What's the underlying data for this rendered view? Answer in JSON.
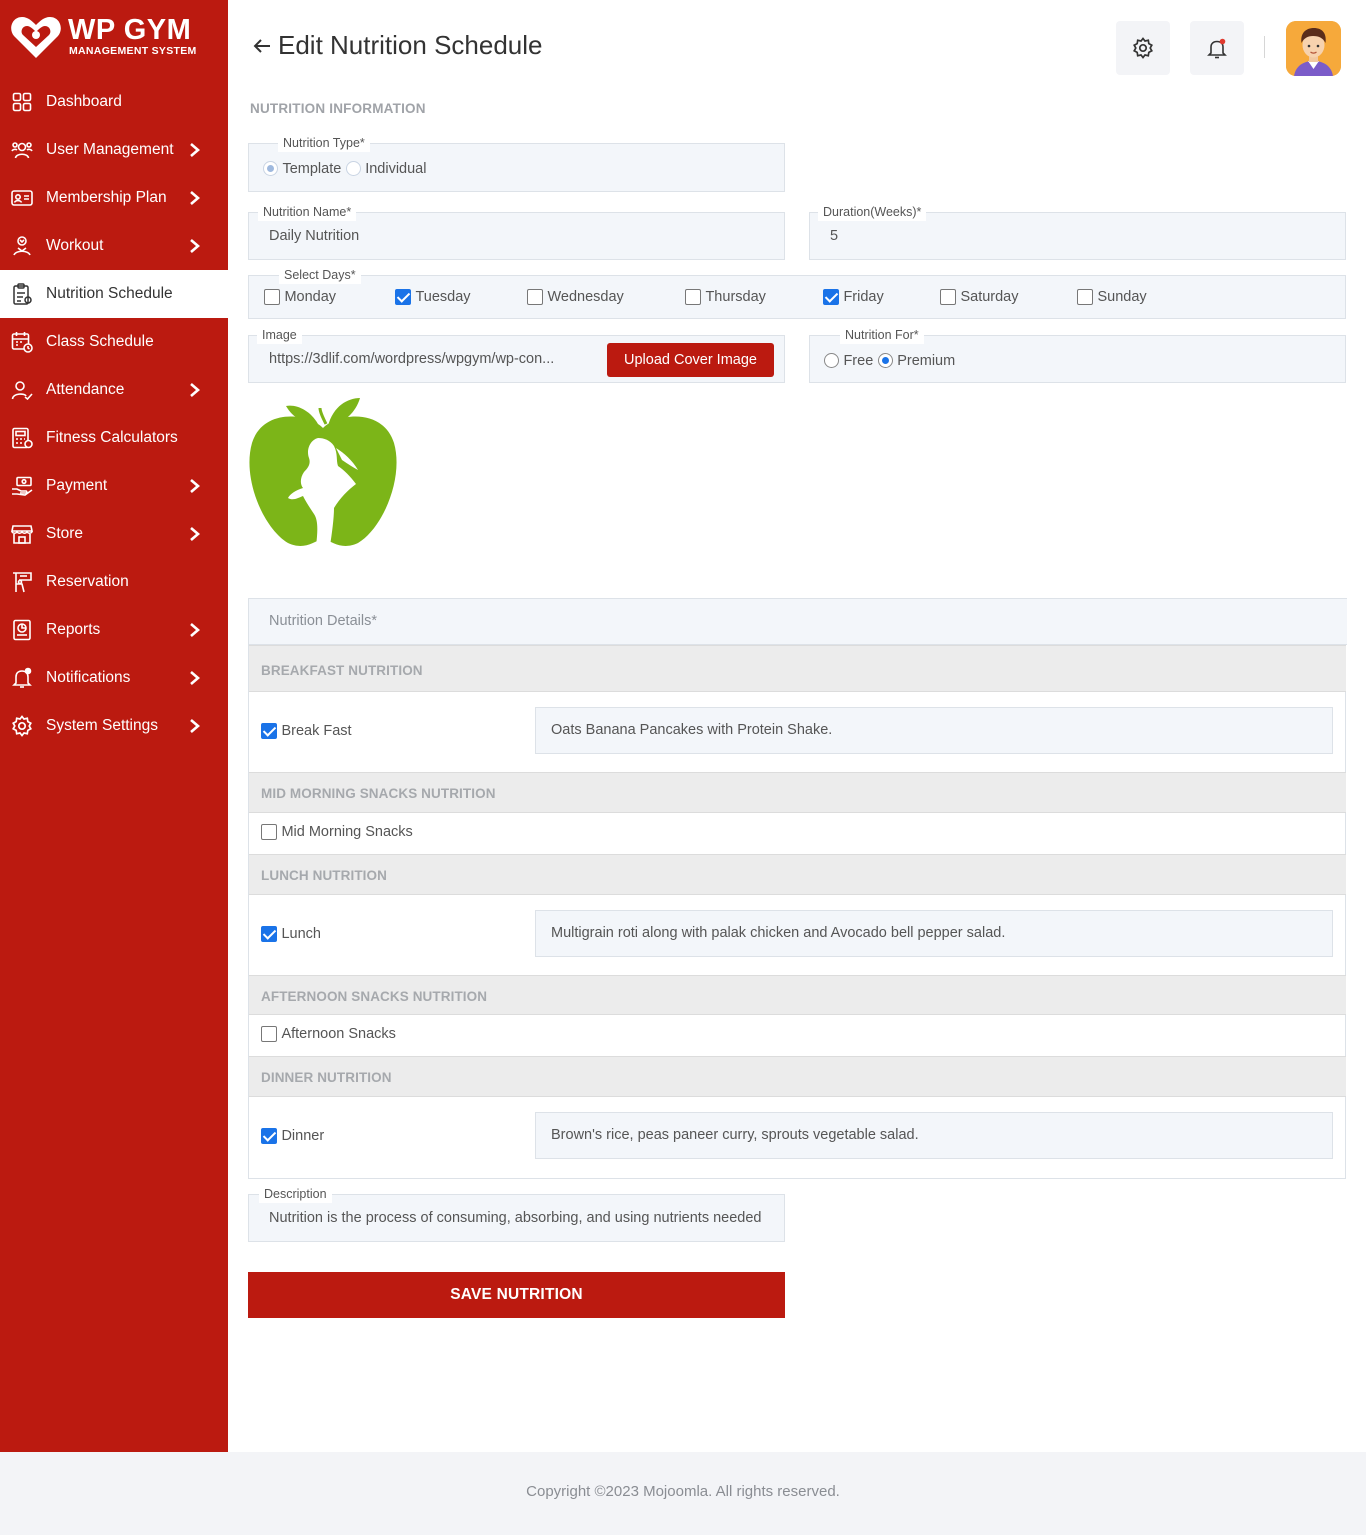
{
  "brand": {
    "title": "WP GYM",
    "subtitle": "MANAGEMENT SYSTEM"
  },
  "sidebar": {
    "items": [
      {
        "label": "Dashboard",
        "icon": "dashboard-icon",
        "chevron": false
      },
      {
        "label": "User Management",
        "icon": "users-icon",
        "chevron": true
      },
      {
        "label": "Membership Plan",
        "icon": "membership-card-icon",
        "chevron": true
      },
      {
        "label": "Workout",
        "icon": "workout-icon",
        "chevron": true
      },
      {
        "label": "Nutrition Schedule",
        "icon": "nutrition-clipboard-icon",
        "chevron": false,
        "active": true
      },
      {
        "label": "Class Schedule",
        "icon": "calendar-icon",
        "chevron": false
      },
      {
        "label": "Attendance",
        "icon": "user-check-icon",
        "chevron": true
      },
      {
        "label": "Fitness Calculators",
        "icon": "calculator-icon",
        "chevron": false
      },
      {
        "label": "Payment",
        "icon": "payment-hand-icon",
        "chevron": true
      },
      {
        "label": "Store",
        "icon": "store-icon",
        "chevron": true
      },
      {
        "label": "Reservation",
        "icon": "reservation-icon",
        "chevron": false
      },
      {
        "label": "Reports",
        "icon": "report-icon",
        "chevron": true
      },
      {
        "label": "Notifications",
        "icon": "bell-icon",
        "chevron": true
      },
      {
        "label": "System Settings",
        "icon": "gear-icon",
        "chevron": true
      }
    ]
  },
  "header": {
    "title": "Edit Nutrition Schedule"
  },
  "form": {
    "section_label": "NUTRITION INFORMATION",
    "nutrition_type": {
      "legend": "Nutrition Type*",
      "options": [
        "Template",
        "Individual"
      ],
      "selected": "Template"
    },
    "nutrition_name": {
      "legend": "Nutrition Name*",
      "value": "Daily Nutrition"
    },
    "duration": {
      "legend": "Duration(Weeks)*",
      "value": "5"
    },
    "select_days": {
      "legend": "Select Days*",
      "days": [
        {
          "label": "Monday",
          "checked": false
        },
        {
          "label": "Tuesday",
          "checked": true
        },
        {
          "label": "Wednesday",
          "checked": false
        },
        {
          "label": "Thursday",
          "checked": false
        },
        {
          "label": "Friday",
          "checked": true
        },
        {
          "label": "Saturday",
          "checked": false
        },
        {
          "label": "Sunday",
          "checked": false
        }
      ]
    },
    "image": {
      "legend": "Image",
      "value": "https://3dlif.com/wordpress/wpgym/wp-con...",
      "upload_label": "Upload Cover Image"
    },
    "nutrition_for": {
      "legend": "Nutrition For*",
      "options": [
        "Free",
        "Premium"
      ],
      "selected": "Premium"
    },
    "details": {
      "header": "Nutrition Details*",
      "sections": [
        {
          "title": "BREAKFAST NUTRITION",
          "label": "Break Fast",
          "checked": true,
          "value": "Oats Banana Pancakes with Protein Shake."
        },
        {
          "title": "MID MORNING SNACKS NUTRITION",
          "label": "Mid Morning Snacks",
          "checked": false,
          "value": ""
        },
        {
          "title": "LUNCH NUTRITION",
          "label": "Lunch",
          "checked": true,
          "value": "Multigrain roti along with palak chicken and Avocado bell pepper salad."
        },
        {
          "title": "AFTERNOON SNACKS NUTRITION",
          "label": "Afternoon Snacks",
          "checked": false,
          "value": ""
        },
        {
          "title": "DINNER NUTRITION",
          "label": "Dinner",
          "checked": true,
          "value": "Brown's rice, peas paneer curry, sprouts vegetable salad."
        }
      ]
    },
    "description": {
      "legend": "Description",
      "value": "Nutrition is the process of consuming, absorbing, and using nutrients needed"
    },
    "save_label": "SAVE NUTRITION"
  },
  "footer": {
    "text": "Copyright ©2023 Mojoomla. All rights reserved."
  },
  "colors": {
    "brand_red": "#bb1a10",
    "accent_blue": "#1a73e8",
    "logo_green": "#7cb518"
  }
}
